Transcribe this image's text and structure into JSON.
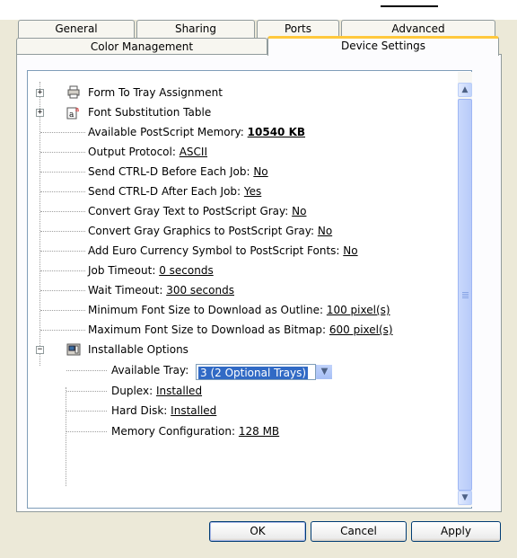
{
  "tabs_row1": [
    {
      "label": "General"
    },
    {
      "label": "Sharing"
    },
    {
      "label": "Ports"
    },
    {
      "label": "Advanced"
    }
  ],
  "tabs_row2": [
    {
      "label": "Color Management"
    },
    {
      "label": "Device Settings",
      "active": true
    }
  ],
  "tree": {
    "form_to_tray": "Form To Tray Assignment",
    "font_substitution": "Font Substitution Table",
    "available_ps_memory": {
      "label": "Available PostScript Memory: ",
      "value": "10540 KB"
    },
    "output_protocol": {
      "label": "Output Protocol: ",
      "value": "ASCII"
    },
    "ctrl_d_before": {
      "label": "Send CTRL-D Before Each Job: ",
      "value": "No"
    },
    "ctrl_d_after": {
      "label": "Send CTRL-D After Each Job: ",
      "value": "Yes"
    },
    "gray_text": {
      "label": "Convert Gray Text to PostScript Gray: ",
      "value": "No"
    },
    "gray_graphics": {
      "label": "Convert Gray Graphics to PostScript Gray: ",
      "value": "No"
    },
    "euro_symbol": {
      "label": "Add Euro Currency Symbol to PostScript Fonts: ",
      "value": "No"
    },
    "job_timeout": {
      "label": "Job Timeout: ",
      "value": "0 seconds"
    },
    "wait_timeout": {
      "label": "Wait Timeout: ",
      "value": "300 seconds"
    },
    "min_font_outline": {
      "label": "Minimum Font Size to Download as Outline: ",
      "value": "100 pixel(s)"
    },
    "max_font_bitmap": {
      "label": "Maximum Font Size to Download as Bitmap: ",
      "value": "600 pixel(s)"
    },
    "installable_options": "Installable Options",
    "available_tray": {
      "label": "Available Tray:",
      "value": "3 (2 Optional Trays)"
    },
    "duplex": {
      "label": "Duplex: ",
      "value": "Installed"
    },
    "hard_disk": {
      "label": "Hard Disk: ",
      "value": "Installed"
    },
    "memory_config": {
      "label": "Memory Configuration: ",
      "value": "128 MB"
    }
  },
  "buttons": {
    "ok": "OK",
    "cancel": "Cancel",
    "apply": "Apply"
  },
  "icons": {
    "expand": "plus-expander-icon",
    "collapse": "minus-expander-icon",
    "printer_tray": "printer-tray-icon",
    "font": "font-icon",
    "options": "installable-options-icon",
    "dropdown": "chevron-down-icon",
    "scroll_up": "scroll-up-icon",
    "scroll_down": "scroll-down-icon"
  },
  "colors": {
    "dialog_bg": "#ece9d8",
    "tab_active_accent": "#ffc83c",
    "selection": "#316ac5",
    "button_border": "#003c74"
  }
}
